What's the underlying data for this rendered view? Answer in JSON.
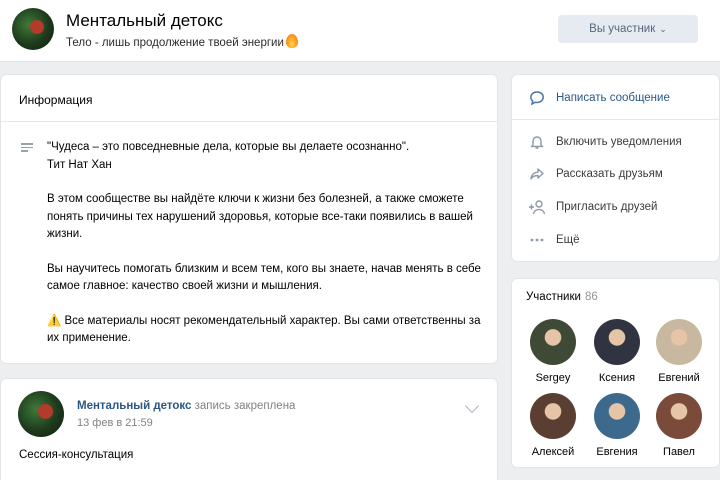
{
  "header": {
    "title": "Ментальный детокс",
    "status": "Тело - лишь продолжение твоей энергии",
    "member_button": "Вы участник",
    "member_button_chevron": "⌄"
  },
  "info": {
    "title": "Информация",
    "paragraphs": [
      "\"Чудеса – это повседневные дела, которые вы делаете осознанно\".",
      "Тит Нат Хан",
      "В этом сообществе вы найдёте ключи к жизни без болезней, а также сможете понять причины тех нарушений здоровья, которые все-таки появились в вашей жизни.",
      "Вы научитесь помогать близким и всем тем, кого вы знаете, начав менять в себе самое главное: качество своей жизни и мышления.",
      "⚠️ Все материалы носят рекомендательный характер. Вы сами ответственны за их применение."
    ]
  },
  "post": {
    "author": "Ментальный детокс",
    "pinned_label": "запись закреплена",
    "date": "13 фев в 21:59",
    "text": "Сессия-консультация"
  },
  "actions": [
    {
      "label": "Написать сообщение",
      "icon": "message-icon"
    },
    {
      "label": "Включить уведомления",
      "icon": "bell-icon"
    },
    {
      "label": "Рассказать друзьям",
      "icon": "share-icon"
    },
    {
      "label": "Пригласить друзей",
      "icon": "invite-icon"
    },
    {
      "label": "Ещё",
      "icon": "more-icon"
    }
  ],
  "members": {
    "title": "Участники",
    "count": "86",
    "list": [
      {
        "name": "Sergey",
        "color": "#3f4a36"
      },
      {
        "name": "Ксения",
        "color": "#2f3440"
      },
      {
        "name": "Евгений",
        "color": "#c9b8a0"
      },
      {
        "name": "Алексей",
        "color": "#5a3e32"
      },
      {
        "name": "Евгения",
        "color": "#3d6a8c"
      },
      {
        "name": "Павел",
        "color": "#7a4a3a"
      }
    ]
  }
}
